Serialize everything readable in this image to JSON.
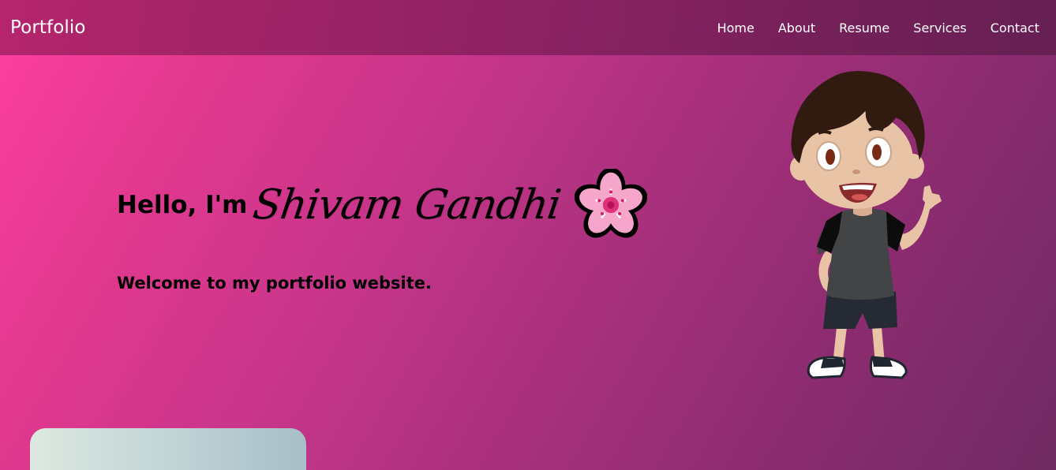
{
  "nav": {
    "brand": "Portfolio",
    "links": [
      "Home",
      "About",
      "Resume",
      "Services",
      "Contact"
    ]
  },
  "hero": {
    "greeting": "Hello, I'm",
    "name": "Shivam Gandhi",
    "subtitle": "Welcome to my portfolio website."
  },
  "icons": {
    "flower": "sakura-flower-icon",
    "avatar": "cartoon-boy-avatar"
  },
  "colors": {
    "gradient_start": "#ff3fa1",
    "gradient_end": "#6f2a62",
    "navbar": "#8a2466",
    "text": "#000000",
    "nav_text": "#ffffff"
  }
}
